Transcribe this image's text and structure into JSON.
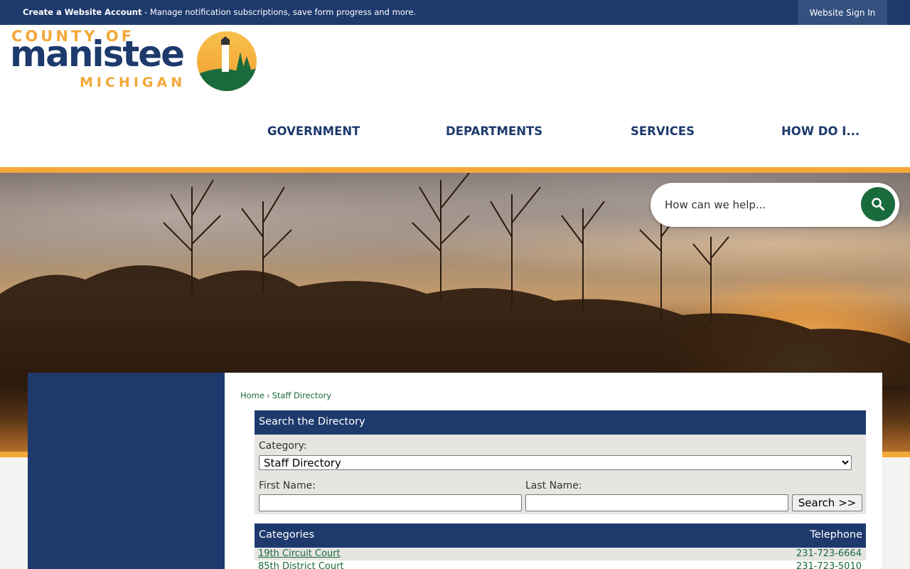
{
  "topbar": {
    "create_label": "Create a Website Account",
    "create_message": " - Manage notification subscriptions, save form progress and more.",
    "signin_label": "Website Sign In"
  },
  "logo": {
    "line1": "COUNTY OF",
    "line2": "manistee",
    "line3": "MICHIGAN"
  },
  "nav": {
    "items": [
      {
        "label": "GOVERNMENT"
      },
      {
        "label": "DEPARTMENTS"
      },
      {
        "label": "SERVICES"
      },
      {
        "label": "HOW DO I..."
      }
    ]
  },
  "search": {
    "placeholder": "How can we help..."
  },
  "breadcrumb": {
    "home": "Home",
    "separator": "›",
    "current": "Staff Directory"
  },
  "directory": {
    "title": "Search the Directory",
    "category_label": "Category:",
    "category_selected": "Staff Directory",
    "first_name_label": "First Name:",
    "last_name_label": "Last Name:",
    "search_button": "Search >>"
  },
  "table": {
    "col_categories": "Categories",
    "col_telephone": "Telephone",
    "rows": [
      {
        "name": "19th Circuit Court",
        "phone": "231-723-6664"
      },
      {
        "name": "85th District Court",
        "phone": "231-723-5010"
      }
    ]
  },
  "colors": {
    "navy": "#1e3a6d",
    "orange": "#f4a83a",
    "green": "#1a6b3c"
  }
}
